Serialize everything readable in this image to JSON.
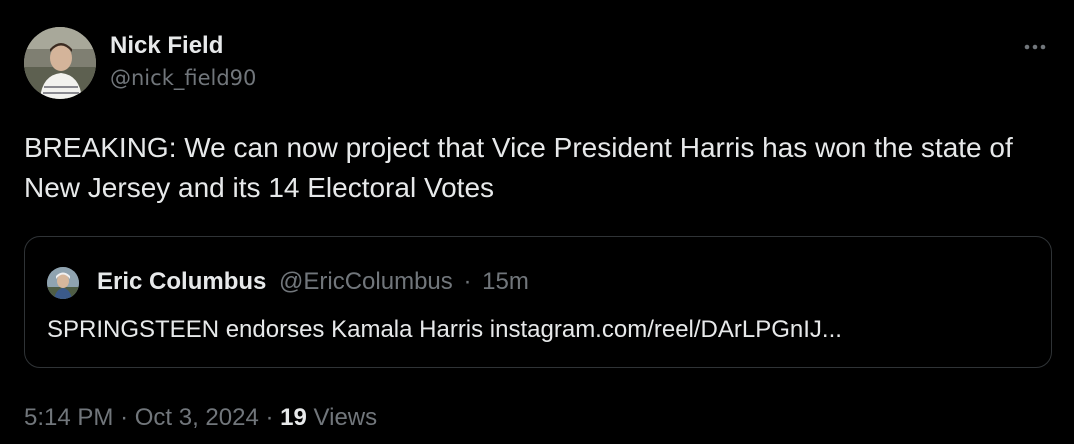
{
  "tweet": {
    "author": {
      "display_name": "Nick Field",
      "handle": "@nick_field90"
    },
    "more_icon": "ellipsis-icon",
    "text": "BREAKING: We can now project that Vice President Harris has won the state of New Jersey and its 14 Electoral Votes",
    "quoted": {
      "display_name": "Eric Columbus",
      "handle": "@EricColumbus",
      "separator": "·",
      "time": "15m",
      "text": "SPRINGSTEEN endorses Kamala Harris instagram.com/reel/DArLPGnIJ..."
    },
    "footer": {
      "time": "5:14 PM",
      "sep1": "·",
      "date": "Oct 3, 2024",
      "sep2": "·",
      "views_count": "19",
      "views_label": "Views"
    }
  },
  "colors": {
    "background": "#000000",
    "primary_text": "#e7e9ea",
    "secondary_text": "#71767b",
    "border": "#2f3336"
  }
}
